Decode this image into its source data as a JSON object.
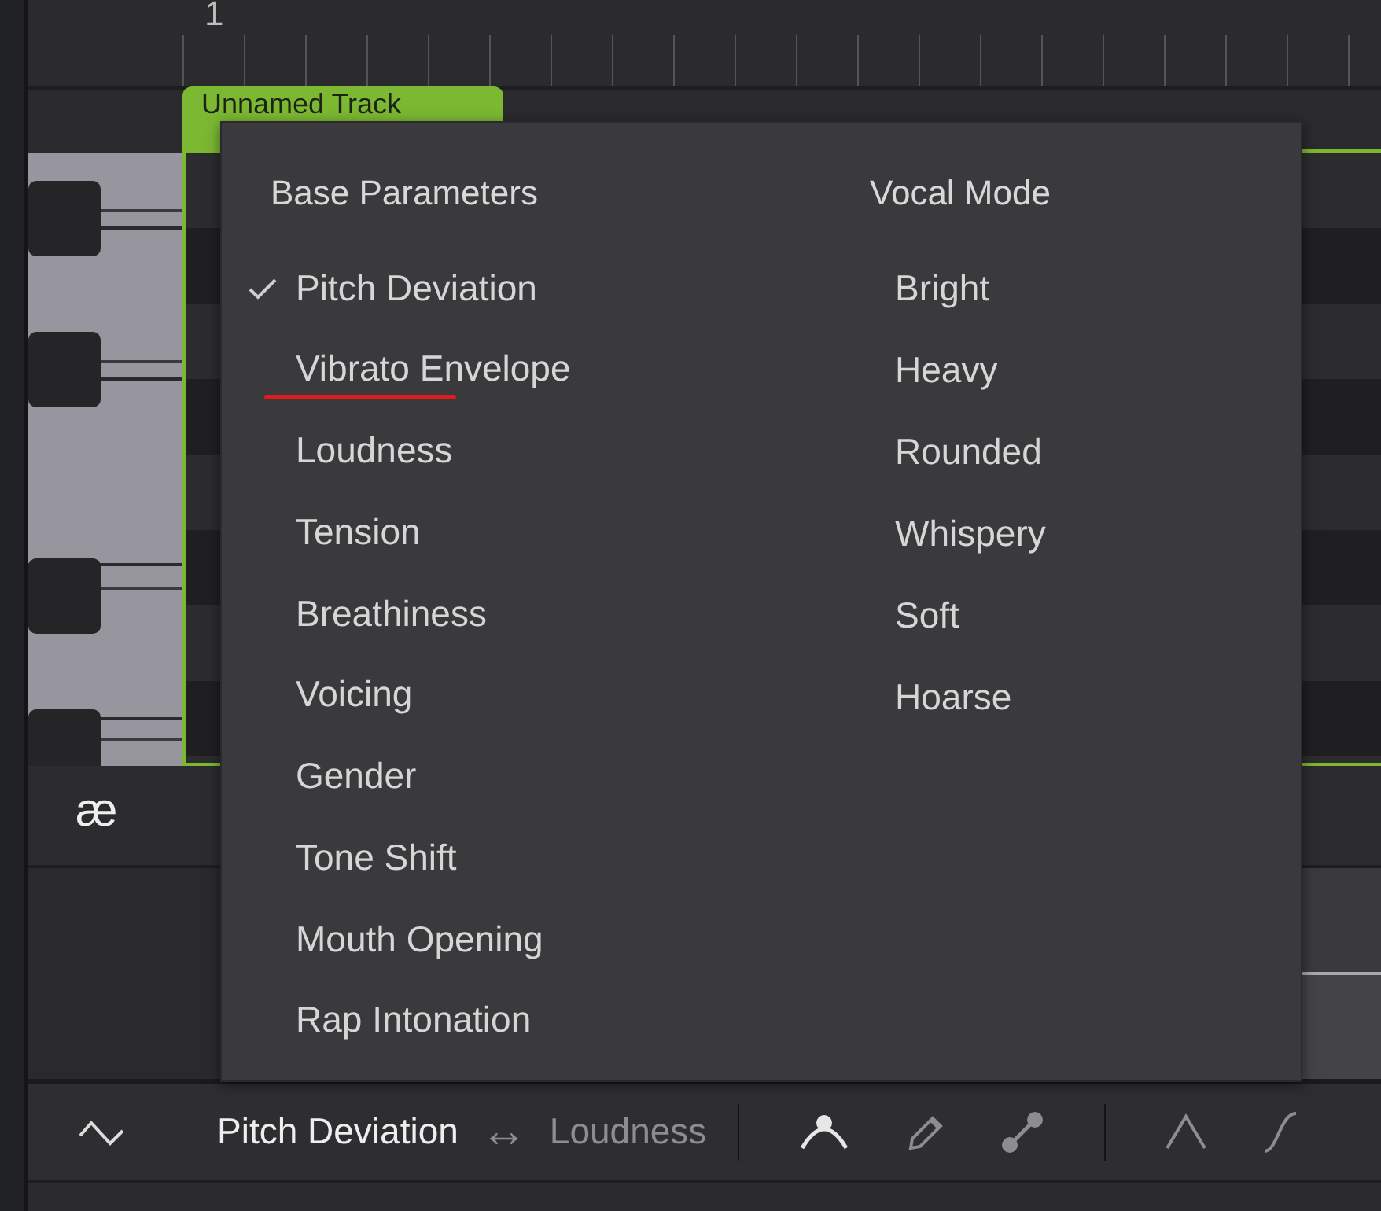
{
  "ruler": {
    "bar_number": "1"
  },
  "track": {
    "title": "Unnamed Track"
  },
  "phoneme_row": {
    "phoneme": "æ"
  },
  "menu": {
    "columns": [
      {
        "heading": "Base Parameters",
        "items": [
          {
            "label": "Pitch Deviation",
            "checked": true,
            "underlined": false
          },
          {
            "label": "Vibrato Envelope",
            "checked": false,
            "underlined": true
          },
          {
            "label": "Loudness",
            "checked": false,
            "underlined": false
          },
          {
            "label": "Tension",
            "checked": false,
            "underlined": false
          },
          {
            "label": "Breathiness",
            "checked": false,
            "underlined": false
          },
          {
            "label": "Voicing",
            "checked": false,
            "underlined": false
          },
          {
            "label": "Gender",
            "checked": false,
            "underlined": false
          },
          {
            "label": "Tone Shift",
            "checked": false,
            "underlined": false
          },
          {
            "label": "Mouth Opening",
            "checked": false,
            "underlined": false
          },
          {
            "label": "Rap Intonation",
            "checked": false,
            "underlined": false
          }
        ]
      },
      {
        "heading": "Vocal Mode",
        "items": [
          {
            "label": "Bright",
            "checked": false,
            "underlined": false
          },
          {
            "label": "Heavy",
            "checked": false,
            "underlined": false
          },
          {
            "label": "Rounded",
            "checked": false,
            "underlined": false
          },
          {
            "label": "Whispery",
            "checked": false,
            "underlined": false
          },
          {
            "label": "Soft",
            "checked": false,
            "underlined": false
          },
          {
            "label": "Hoarse",
            "checked": false,
            "underlined": false
          }
        ]
      }
    ]
  },
  "toolbar": {
    "primary": "Pitch Deviation",
    "swap": "↔",
    "secondary": "Loudness",
    "tools": [
      {
        "kind": "curve",
        "selected": true
      },
      {
        "kind": "pencil",
        "selected": false
      },
      {
        "kind": "line",
        "selected": false
      },
      {
        "kind": "peak",
        "selected": false
      },
      {
        "kind": "scurve",
        "selected": false
      }
    ]
  }
}
